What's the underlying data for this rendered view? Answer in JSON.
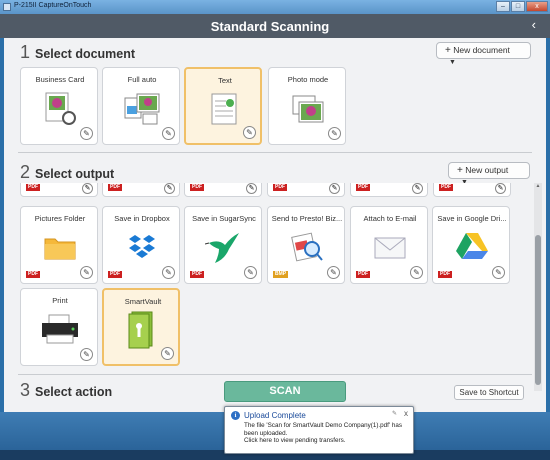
{
  "window": {
    "title": "P-215II CaptureOnTouch",
    "btn_min": "–",
    "btn_max": "□",
    "btn_close": "x"
  },
  "header": {
    "title": "Standard Scanning",
    "back_icon": "‹"
  },
  "section1": {
    "num": "1",
    "label": "Select document",
    "new_button": "New document",
    "plus": "+",
    "caret": "▼",
    "tiles": [
      {
        "label": "Business Card"
      },
      {
        "label": "Full auto"
      },
      {
        "label": "Text"
      },
      {
        "label": "Photo mode"
      }
    ]
  },
  "section2": {
    "num": "2",
    "label": "Select output",
    "new_button": "New output",
    "plus": "+",
    "caret": "▼",
    "partial_badges": [
      "PDF",
      "PDF",
      "PDF",
      "PDF",
      "PDF",
      "PDF"
    ],
    "tiles": [
      {
        "label": "Pictures Folder",
        "badge": "PDF"
      },
      {
        "label": "Save in Dropbox",
        "badge": "PDF"
      },
      {
        "label": "Save in SugarSync",
        "badge": "PDF"
      },
      {
        "label": "Send to Presto! Biz...",
        "badge": "BMP"
      },
      {
        "label": "Attach to E-mail",
        "badge": "PDF"
      },
      {
        "label": "Save in Google Dri...",
        "badge": "PDF"
      },
      {
        "label": "Print",
        "badge": ""
      },
      {
        "label": "SmartVault",
        "badge": ""
      }
    ]
  },
  "section3": {
    "num": "3",
    "label": "Select action",
    "scan_button": "SCAN",
    "shortcut_button": "Save to Shortcut"
  },
  "pencil": "✎",
  "scroll_up": "▲",
  "notification": {
    "icon": "i",
    "title": "Upload Complete",
    "line1": "The file 'Scan for SmartVault Demo Company(1).pdf' has",
    "line2": "been uploaded.",
    "line3": "Click here to view pending transfers.",
    "close": "x",
    "pin": "✎"
  },
  "colors": {
    "header": "#505a66",
    "selected_fill": "#fdf3df",
    "selected_border": "#f0c068",
    "scan": "#6ab89c",
    "pdf_badge": "#cc2020",
    "bmp_badge": "#e0a020"
  }
}
